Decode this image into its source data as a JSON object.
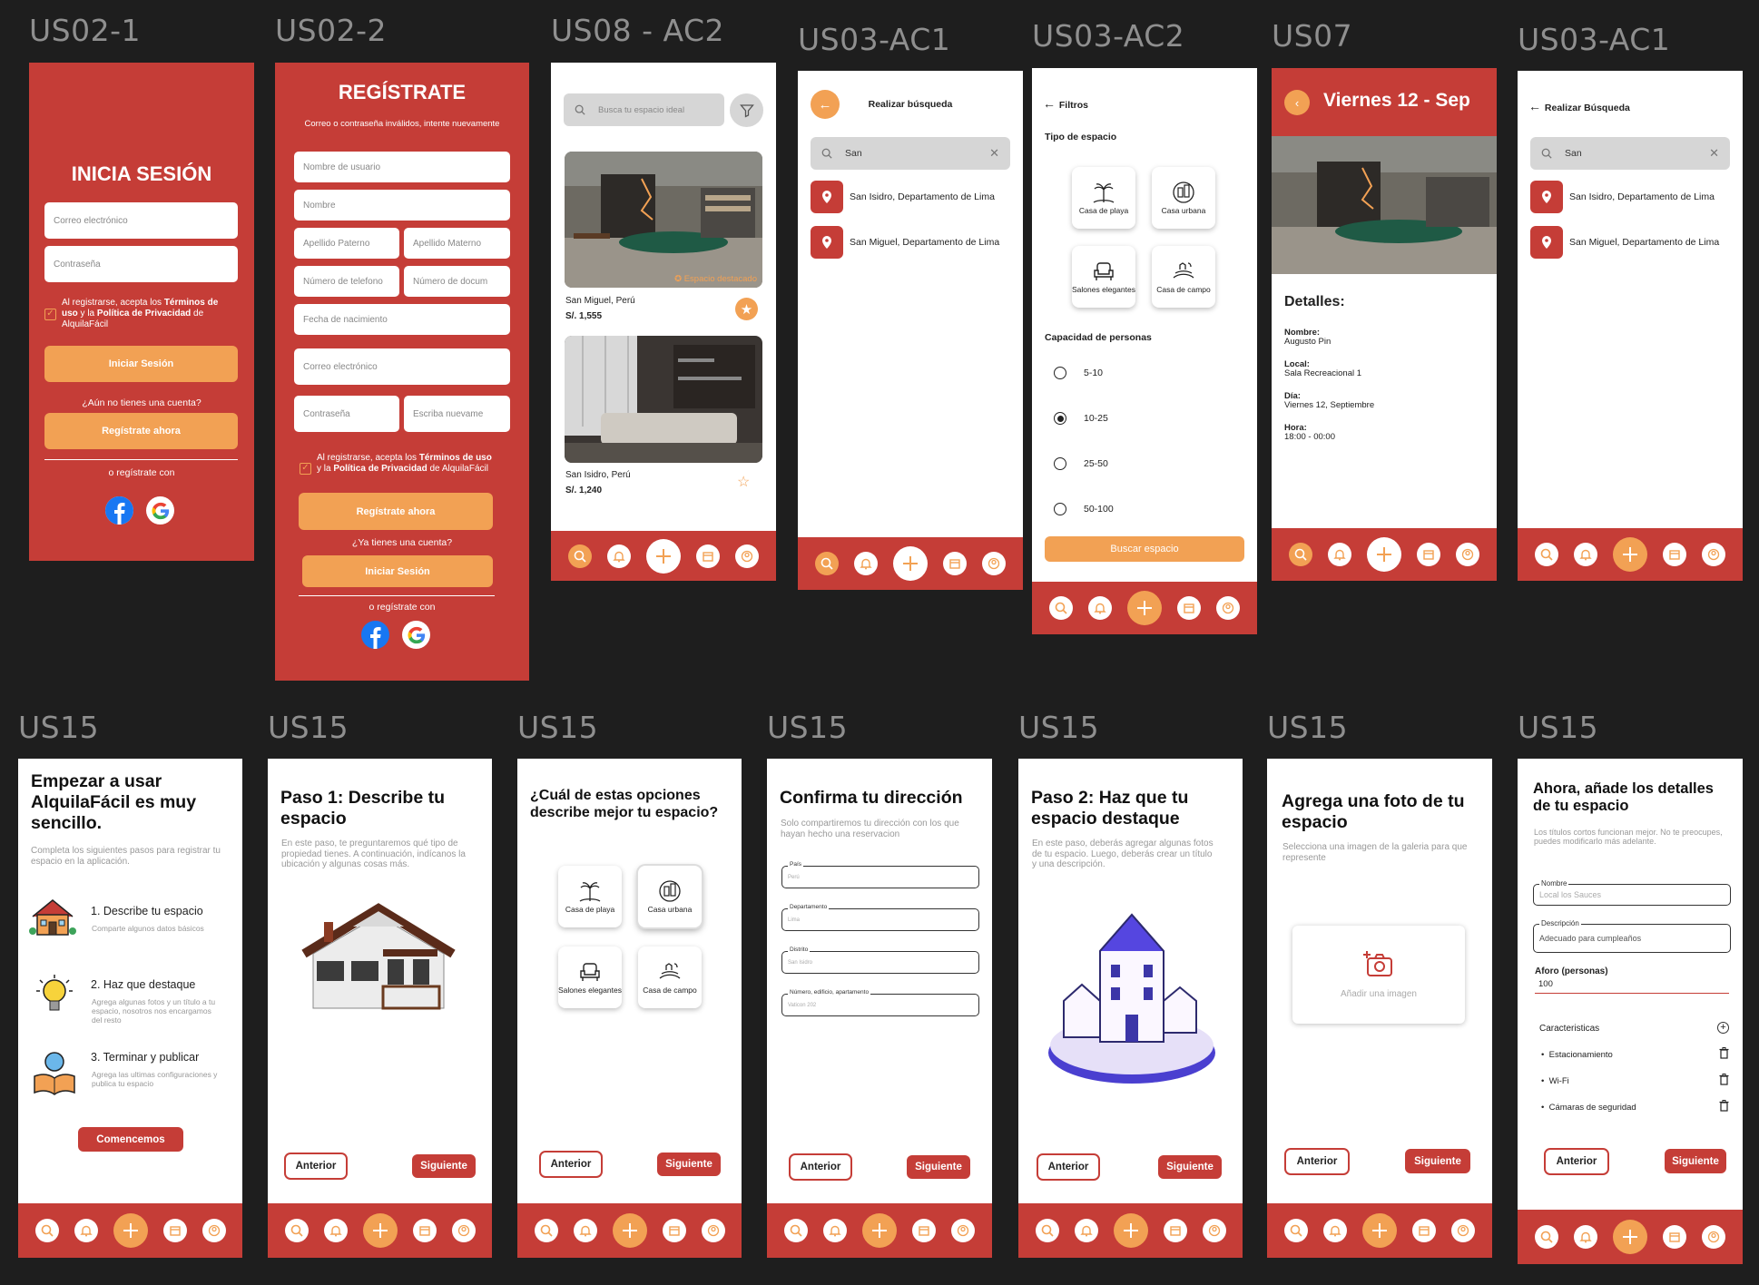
{
  "colors": {
    "primary": "#c53d37",
    "accent": "#f2a154",
    "canvas": "#1e1e1e"
  },
  "labels": [
    "US02-1",
    "US02-2",
    "US08 - AC2",
    "US03-AC1",
    "US03-AC2",
    "US07",
    "US03-AC1",
    "US15",
    "US15",
    "US15",
    "US15",
    "US15",
    "US15",
    "US15"
  ],
  "nav_icons": [
    "search-icon",
    "bell-icon",
    "plus-icon",
    "calendar-icon",
    "user-icon"
  ],
  "login": {
    "title": "INICIA SESIÓN",
    "email_ph": "Correo electrónico",
    "password_ph": "Contraseña",
    "legal_a": "Al registrarse, acepta los ",
    "legal_b": "Términos de uso",
    "legal_c": " y la ",
    "legal_d": "Política de Privacidad",
    "legal_e": " de AlquilaFácil",
    "login_btn": "Iniciar Sesión",
    "no_account": "¿Aún no tienes una cuenta?",
    "register_btn": "Regístrate ahora",
    "or_with": "o regístrate con"
  },
  "register": {
    "title": "REGÍSTRATE",
    "error": "Correo o contraseña inválidos, intente nuevamente",
    "username_ph": "Nombre de usuario",
    "name_ph": "Nombre",
    "last1_ph": "Apellido Paterno",
    "last2_ph": "Apellido Materno",
    "phone_ph": "Número de telefono",
    "doc_ph": "Número de docum",
    "birth_ph": "Fecha de nacimiento",
    "email_ph": "Correo electrónico",
    "password_ph": "Contraseña",
    "repeat_ph": "Escriba nuevame",
    "legal_a": "Al registrarse, acepta los ",
    "legal_b": "Términos de uso",
    "legal_c": " y la ",
    "legal_d": "Política de Privacidad",
    "legal_e": " de AlquilaFácil",
    "register_btn": "Regístrate ahora",
    "has_account": "¿Ya tienes una cuenta?",
    "login_btn": "Iniciar Sesión",
    "or_with": "o regístrate con"
  },
  "listing": {
    "search_ph": "Busca tu espacio ideal",
    "featured": "Espacio destacado",
    "items": [
      {
        "location": "San Miguel, Perú",
        "price": "S/. 1,555"
      },
      {
        "location": "San Isidro, Perú",
        "price": "S/. 1,240"
      }
    ]
  },
  "search1": {
    "title": "Realizar búsqueda",
    "query": "San",
    "results": [
      "San Isidro, Departamento de Lima",
      "San Miguel, Departamento de Lima"
    ]
  },
  "filters": {
    "title": "Filtros",
    "type_title": "Tipo de espacio",
    "types": [
      "Casa de playa",
      "Casa urbana",
      "Salones elegantes",
      "Casa de campo"
    ],
    "capacity_title": "Capacidad de personas",
    "options": [
      "5-10",
      "10-25",
      "25-50",
      "50-100"
    ],
    "selected": "10-25",
    "button": "Buscar espacio"
  },
  "detail": {
    "date": "Viernes 12 - Sep",
    "heading": "Detalles:",
    "fields": [
      {
        "label": "Nombre:",
        "value": "Augusto Pin"
      },
      {
        "label": "Local:",
        "value": "Sala Recreacional 1"
      },
      {
        "label": "Día:",
        "value": "Viernes 12, Septiembre"
      },
      {
        "label": "Hora:",
        "value": "18:00 - 00:00"
      }
    ]
  },
  "search2": {
    "title": "Realizar Búsqueda",
    "query": "San",
    "results": [
      "San Isidro, Departamento de Lima",
      "San Miguel, Departamento de Lima"
    ]
  },
  "intro": {
    "title": "Empezar a usar AlquilaFácil es muy sencillo.",
    "subtitle": "Completa los siguientes pasos para registrar tu espacio en la aplicación.",
    "steps": [
      {
        "title": "1.  Describe tu espacio",
        "desc": "Comparte algunos datos básicos"
      },
      {
        "title": "2.  Haz que destaque",
        "desc": "Agrega algunas fotos y un título a tu espacio, nosotros nos encargamos del resto"
      },
      {
        "title": "3.  Terminar y publicar",
        "desc": "Agrega las ultimas configuraciones y publica tu espacio"
      }
    ],
    "button": "Comencemos"
  },
  "step1": {
    "title": "Paso 1: Describe tu espacio",
    "desc": "En este paso, te preguntaremos qué tipo de propiedad tienes. A continuación, indícanos la ubicación y algunas cosas más."
  },
  "choose": {
    "title": "¿Cuál de estas opciones describe mejor tu espacio?",
    "types": [
      "Casa de playa",
      "Casa urbana",
      "Salones elegantes",
      "Casa de campo"
    ]
  },
  "address": {
    "title": "Confirma tu dirección",
    "desc": "Solo compartiremos tu dirección con los que hayan hecho una reservacion",
    "fields": [
      {
        "label": "País",
        "value": "Perú"
      },
      {
        "label": "Departamento",
        "value": "Lima"
      },
      {
        "label": "Distrito",
        "value": "San Isidro"
      },
      {
        "label": "Número, edificio, apartamento",
        "value": "Vaticon 202"
      }
    ]
  },
  "step2": {
    "title": "Paso 2: Haz que tu espacio destaque",
    "desc": "En este paso, deberás agregar algunas fotos de tu espacio. Luego, deberás crear un título y una descripción."
  },
  "photo": {
    "title": "Agrega una foto de tu espacio",
    "desc": "Selecciona una imagen de la galeria para que represente",
    "add": "Añadir una imagen"
  },
  "details": {
    "title": "Ahora, añade los detalles de tu espacio",
    "desc": "Los títulos cortos funcionan mejor. No te preocupes, puedes modificarlo más adelante.",
    "name_label": "Nombre",
    "name_value": "Local los Sauces",
    "desc_label": "Descripción",
    "desc_value": "Adecuado para cumpleaños",
    "cap_label": "Aforo (personas)",
    "cap_value": "100",
    "features_title": "Caracteristicas",
    "features": [
      "Estacionamiento",
      "Wi-Fi",
      "Cámaras de seguridad"
    ]
  },
  "buttons": {
    "prev": "Anterior",
    "next": "Siguiente"
  }
}
